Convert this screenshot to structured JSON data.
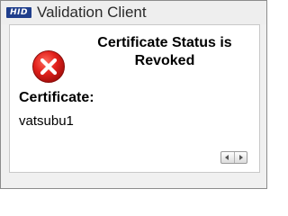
{
  "window": {
    "title": "Validation Client",
    "logo_text": "HID",
    "logo_color": "#1f3e8c"
  },
  "dialog": {
    "status_heading": "Certificate Status is Revoked",
    "status_icon": "error-icon",
    "status_icon_color": "#e2211c",
    "certificate_label": "Certificate:",
    "certificate_value": "vatsubu1"
  },
  "scroll": {
    "left_icon": "arrow-left-icon",
    "right_icon": "arrow-right-icon"
  }
}
